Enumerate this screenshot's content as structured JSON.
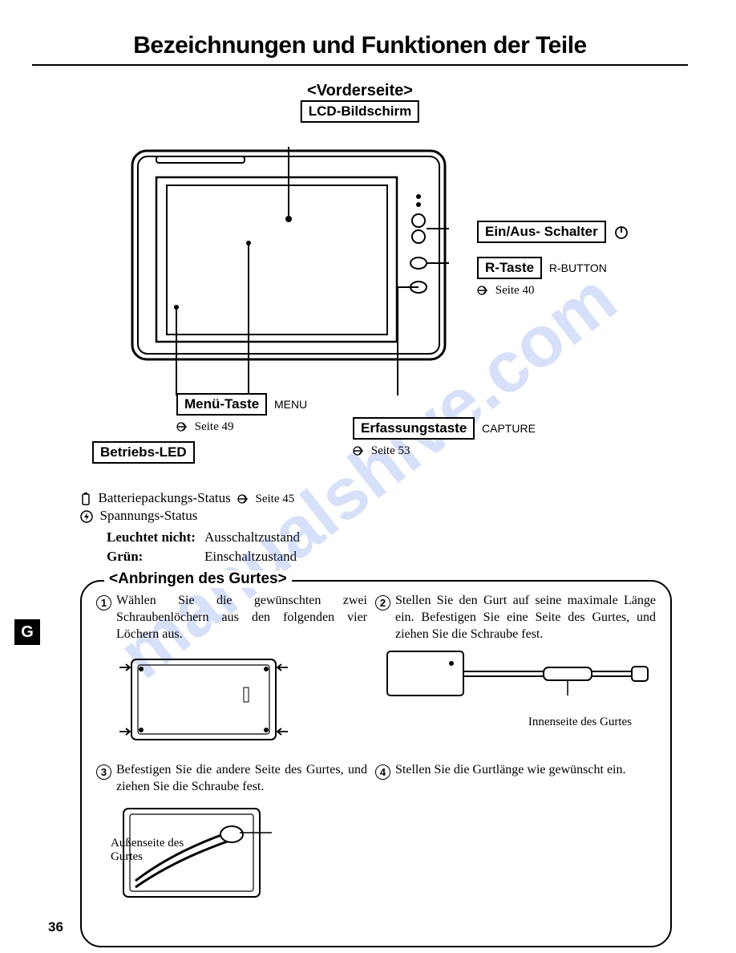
{
  "title": "Bezeichnungen und Funktionen der Teile",
  "front": {
    "heading": "<Vorderseite>",
    "lcd": "LCD-Bildschirm",
    "power_switch": "Ein/Aus- Schalter",
    "r_button": "R-Taste",
    "r_button_caption": "R-BUTTON",
    "r_button_ref": "Seite 40",
    "capture_button": "Erfassungstaste",
    "capture_caption": "CAPTURE",
    "capture_ref": "Seite 53",
    "menu_button": "Menü-Taste",
    "menu_caption": "MENU",
    "menu_ref": "Seite 49",
    "op_led": "Betriebs-LED"
  },
  "status": {
    "battery": "Batteriepackungs-Status",
    "battery_ref": "Seite 45",
    "voltage": "Spannungs-Status",
    "off_label": "Leuchtet nicht:",
    "off_value": "Ausschaltzustand",
    "on_label": "Grün:",
    "on_value": "Einschaltzustand"
  },
  "strap": {
    "heading": "<Anbringen des Gurtes>",
    "step1": "Wählen Sie die gewünschten zwei Schraubenlöchern aus den folgenden vier Löchern aus.",
    "step2": "Stellen Sie den Gurt auf seine maximale Länge ein. Befestigen Sie eine Seite des Gurtes, und ziehen Sie die Schraube fest.",
    "step2_caption": "Innenseite des Gurtes",
    "step3": "Befestigen Sie die andere Seite des Gurtes, und ziehen Sie die Schraube fest.",
    "step3_caption": "Außenseite des Gurtes",
    "step4": "Stellen Sie die Gurtlänge wie gewünscht ein."
  },
  "side_tab": "G",
  "page_number": "36",
  "watermark": "manualshive.com"
}
